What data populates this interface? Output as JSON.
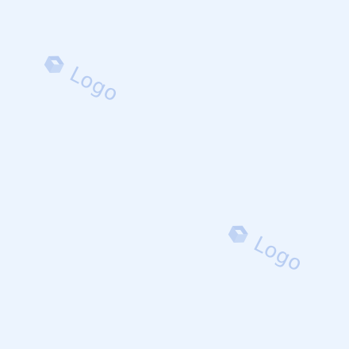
{
  "watermark": {
    "text": "Logo",
    "icon": "cube-logo-icon",
    "color": "#b8cdf2",
    "background": "#ecf4fe"
  }
}
